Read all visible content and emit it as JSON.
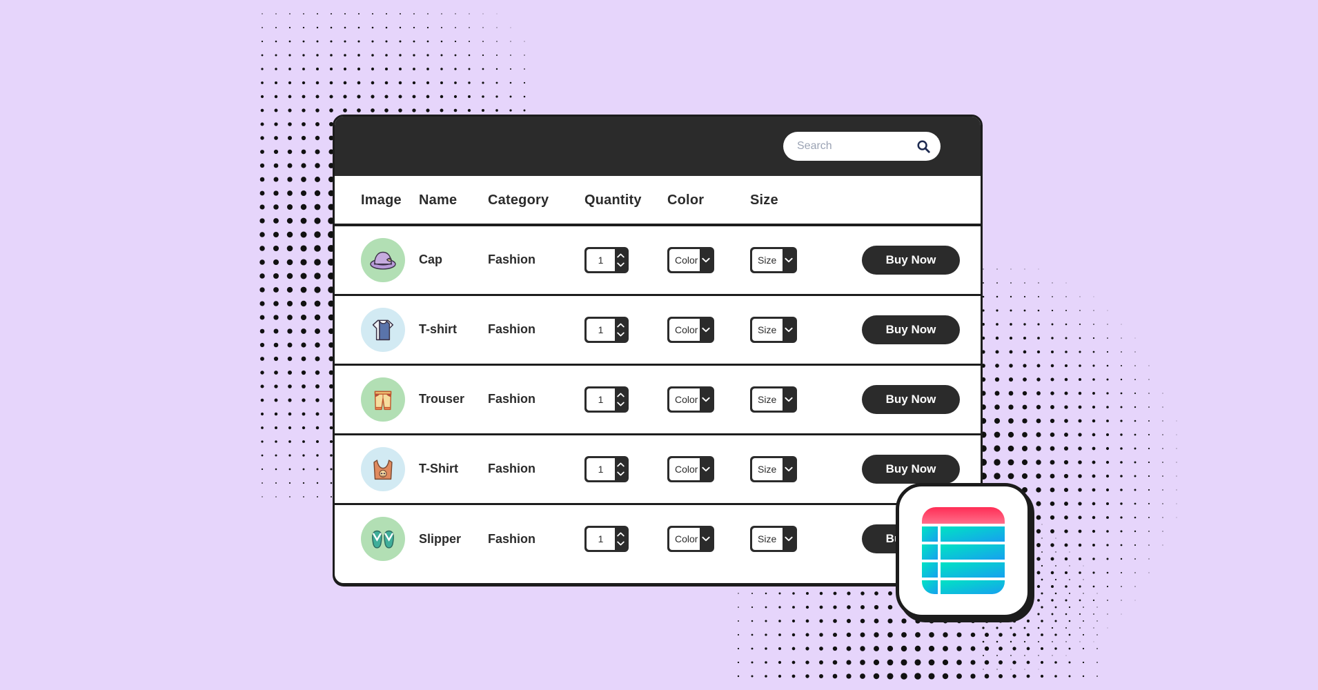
{
  "page": {
    "background_color": "#e6d5fb",
    "dot_color": "#111111"
  },
  "app": {
    "card_border_color": "#1c1c1c",
    "topbar_color": "#2b2b2b",
    "accent_dark": "#2b2b2b"
  },
  "search": {
    "placeholder": "Search",
    "value": "",
    "icon": "search-icon"
  },
  "table": {
    "headers": {
      "image": "Image",
      "name": "Name",
      "category": "Category",
      "quantity": "Quantity",
      "color": "Color",
      "size": "Size"
    },
    "controls": {
      "color_label": "Color",
      "size_label": "Size",
      "buy_label": "Buy Now",
      "qty_up_icon": "chevron-up-icon",
      "qty_down_icon": "chevron-down-icon",
      "select_caret_icon": "chevron-down-icon"
    },
    "rows": [
      {
        "image_icon": "sun-hat-icon",
        "thumb_bg": "#b2dfb4",
        "name": "Cap",
        "category": "Fashion",
        "quantity": "1",
        "color": "Color",
        "size": "Size",
        "buy": "Buy Now"
      },
      {
        "image_icon": "tshirt-icon",
        "thumb_bg": "#d2eaf3",
        "name": "T-shirt",
        "category": "Fashion",
        "quantity": "1",
        "color": "Color",
        "size": "Size",
        "buy": "Buy Now"
      },
      {
        "image_icon": "shorts-icon",
        "thumb_bg": "#b2dfb4",
        "name": "Trouser",
        "category": "Fashion",
        "quantity": "1",
        "color": "Color",
        "size": "Size",
        "buy": "Buy Now"
      },
      {
        "image_icon": "tank-top-icon",
        "thumb_bg": "#d2eaf3",
        "name": "T-Shirt",
        "category": "Fashion",
        "quantity": "1",
        "color": "Color",
        "size": "Size",
        "buy": "Buy Now"
      },
      {
        "image_icon": "flip-flops-icon",
        "thumb_bg": "#b2dfb4",
        "name": "Slipper",
        "category": "Fashion",
        "quantity": "1",
        "color": "Color",
        "size": "Size",
        "buy": "Buy Now"
      }
    ]
  },
  "floating_app": {
    "icon": "table-grid-icon",
    "header_color_top": "#ff3a5e",
    "header_color_bottom": "#ff6b88",
    "row_color_left": "#00d9c0",
    "row_color_right": "#17a9f0"
  }
}
